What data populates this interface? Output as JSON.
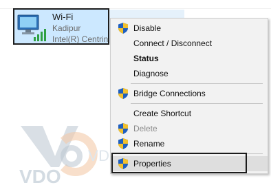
{
  "adapter": {
    "name": "Wi-Fi",
    "network": "Kadipur",
    "device": "Intel(R) Centrino",
    "icon": "wifi-adapter-icon"
  },
  "watermark": {
    "logo_text": "VDO",
    "text": "VDO Data"
  },
  "context_menu": {
    "items": [
      {
        "label": "Disable",
        "icon": "uac-shield-icon"
      },
      {
        "label": "Connect / Disconnect"
      },
      {
        "label": "Status",
        "bold": true
      },
      {
        "label": "Diagnose"
      },
      {
        "label": "Bridge Connections",
        "icon": "uac-shield-icon"
      },
      {
        "label": "Create Shortcut"
      },
      {
        "label": "Delete",
        "icon": "uac-shield-icon",
        "disabled": true
      },
      {
        "label": "Rename",
        "icon": "uac-shield-icon"
      },
      {
        "label": "Properties",
        "icon": "uac-shield-icon",
        "highlighted": true
      }
    ]
  },
  "colors": {
    "selection": "#cce8ff",
    "menu_background": "#f2f2f2",
    "signal_green": "#2ea043"
  }
}
